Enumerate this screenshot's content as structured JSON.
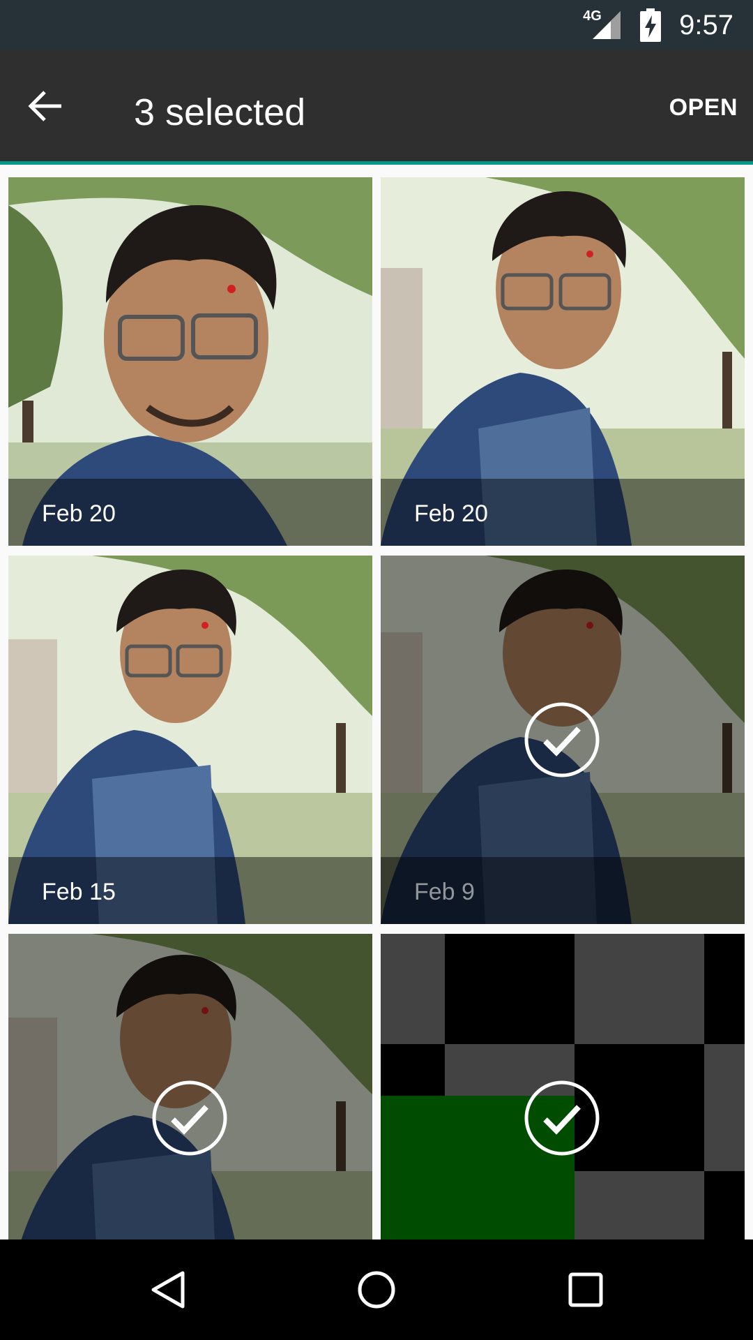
{
  "status_bar": {
    "network_label": "4G",
    "time": "9:57",
    "icons": [
      "signal-icon",
      "battery-charging-icon"
    ]
  },
  "app_bar": {
    "back_icon": "arrow-back-icon",
    "title": "3 selected",
    "action_label": "OPEN",
    "accent_color": "#009688"
  },
  "photos": [
    {
      "date": "Feb 20",
      "selected": false
    },
    {
      "date": "Feb 20",
      "selected": false
    },
    {
      "date": "Feb 15",
      "selected": false
    },
    {
      "date": "Feb 9",
      "selected": true
    },
    {
      "date": "",
      "selected": true
    },
    {
      "date": "",
      "selected": true
    }
  ],
  "nav_bar": {
    "icons": [
      "back-triangle-icon",
      "home-circle-icon",
      "recents-square-icon"
    ]
  }
}
